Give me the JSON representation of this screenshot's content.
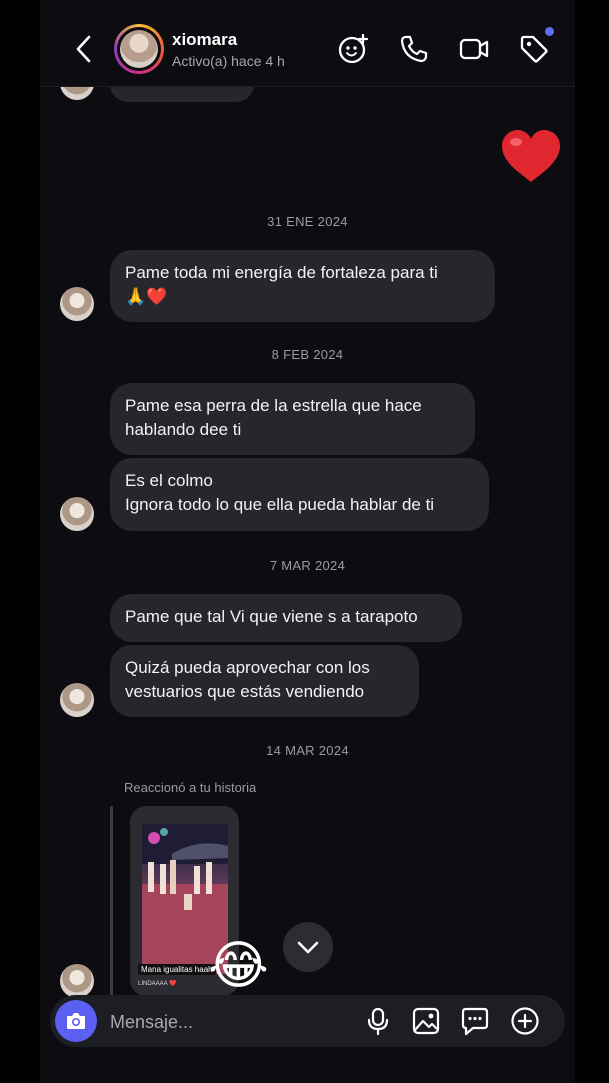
{
  "header": {
    "contact_name": "xiomara",
    "status": "Activo(a) hace 4 h"
  },
  "chat": {
    "dates": [
      "31 ENE 2024",
      "8 FEB 2024",
      "7 MAR 2024",
      "14 MAR 2024"
    ],
    "messages": {
      "m1": "Pame toda mi energía de fortaleza para ti\n🙏❤️",
      "m2": "Pame esa perra de la estrella que hace\nhablando dee ti",
      "m3": "Es el colmo\nIgnora todo lo que ella pueda hablar de ti",
      "m4": "Pame que tal Vi que viene s a tarapoto",
      "m5": "Quizá pueda aprovechar con los\nvestuarios que estás vendiendo"
    },
    "sent_reaction": "❤️",
    "story_reply": {
      "label": "Reaccionó a tu historia",
      "caption": "Mana igualitas haah",
      "subcaption": "LINDAAAA ❤️",
      "reaction_emoji": "😂"
    }
  },
  "composer": {
    "placeholder": "Mensaje..."
  },
  "colors": {
    "background": "#0c0c11",
    "bubble": "#26262c",
    "accent": "#5b5ff2",
    "heart": "#e0272f"
  },
  "icons": [
    "back-arrow-icon",
    "effects-icon",
    "phone-icon",
    "video-camera-icon",
    "tag-icon",
    "camera-icon",
    "microphone-icon",
    "gallery-icon",
    "sticker-icon",
    "add-icon",
    "chevron-down-icon"
  ]
}
